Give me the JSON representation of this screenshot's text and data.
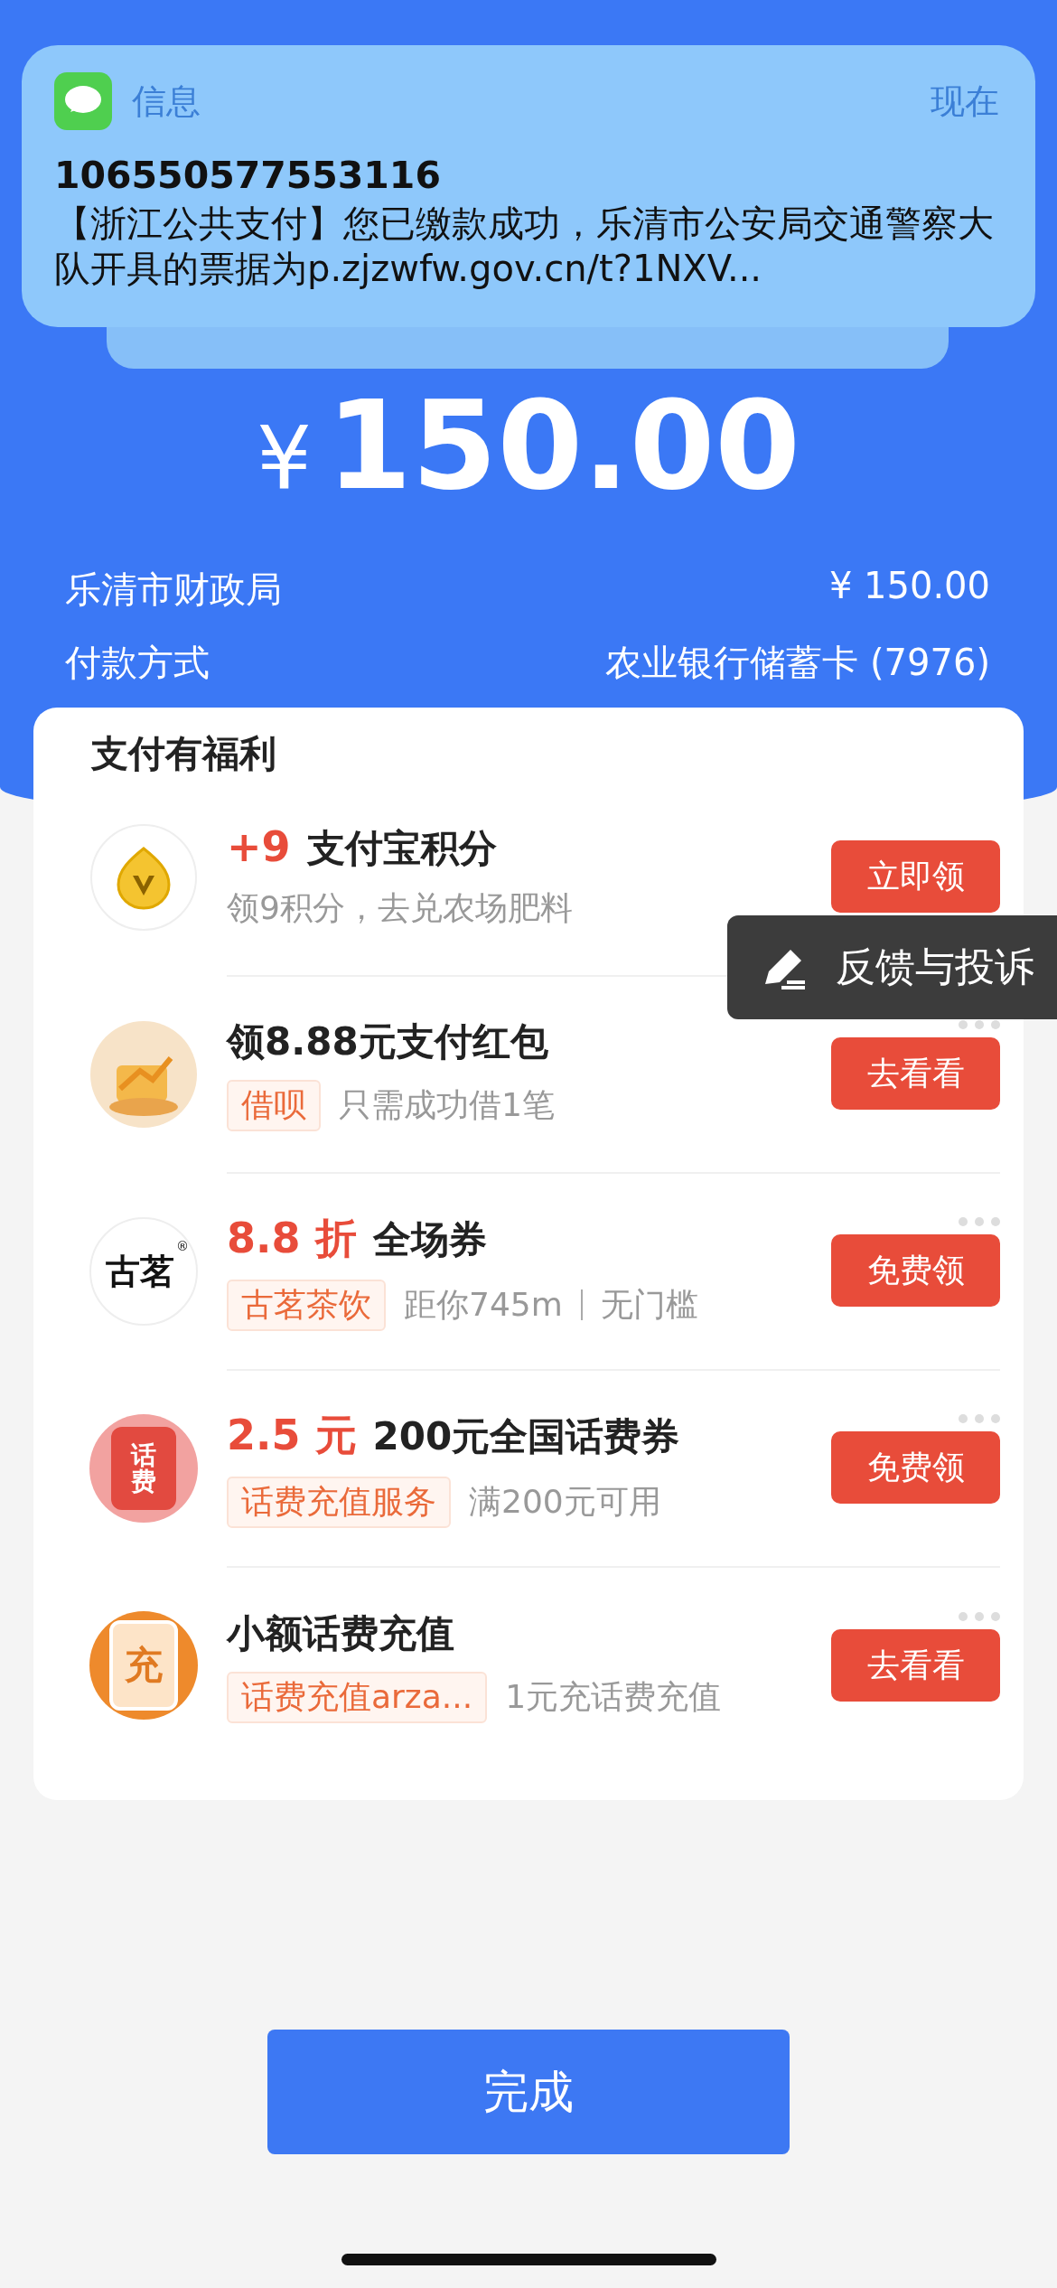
{
  "notification": {
    "app": "信息",
    "time": "现在",
    "sender": "106550577553116",
    "body": "【浙江公共支付】您已缴款成功，乐清市公安局交通警察大队开具的票据为p.zjzwfw.gov.cn/t?1NXV..."
  },
  "amount": {
    "currency": "¥",
    "value": "150.00"
  },
  "details": [
    {
      "label": "乐清市财政局",
      "value": "¥ 150.00"
    },
    {
      "label": "付款方式",
      "value": "农业银行储蓄卡 (7976)"
    }
  ],
  "benefits": {
    "title": "支付有福利",
    "items": [
      {
        "kind": "coin",
        "highlight": "+9",
        "title": "支付宝积分",
        "desc": [
          "领9积分，去兑农场肥料"
        ],
        "button": "立即领",
        "more_menu": false
      },
      {
        "kind": "redpacket",
        "title": "领8.88元支付红包",
        "tag": "借呗",
        "desc": [
          "只需成功借1笔"
        ],
        "button": "去看看",
        "more_menu": true
      },
      {
        "kind": "logo",
        "logo_text": "古茗",
        "logo_mark": "®",
        "highlight": "8.8 折",
        "title": "全场券",
        "tag": "古茗茶饮",
        "desc": [
          "距你745m",
          "无门槛"
        ],
        "button": "免费领",
        "more_menu": true
      },
      {
        "kind": "phonecard",
        "logo_text": "话费",
        "highlight": "2.5 元",
        "title": "200元全国话费券",
        "tag": "话费充值服务",
        "desc": [
          "满200元可用"
        ],
        "button": "免费领",
        "more_menu": true
      },
      {
        "kind": "recharge",
        "logo_text": "充",
        "title": "小额话费充值",
        "tag": "话费充值arza...",
        "desc": [
          "1元充话费充值"
        ],
        "button": "去看看",
        "more_menu": true
      }
    ]
  },
  "feedback": {
    "label": "反馈与投诉"
  },
  "done_button": "完成"
}
